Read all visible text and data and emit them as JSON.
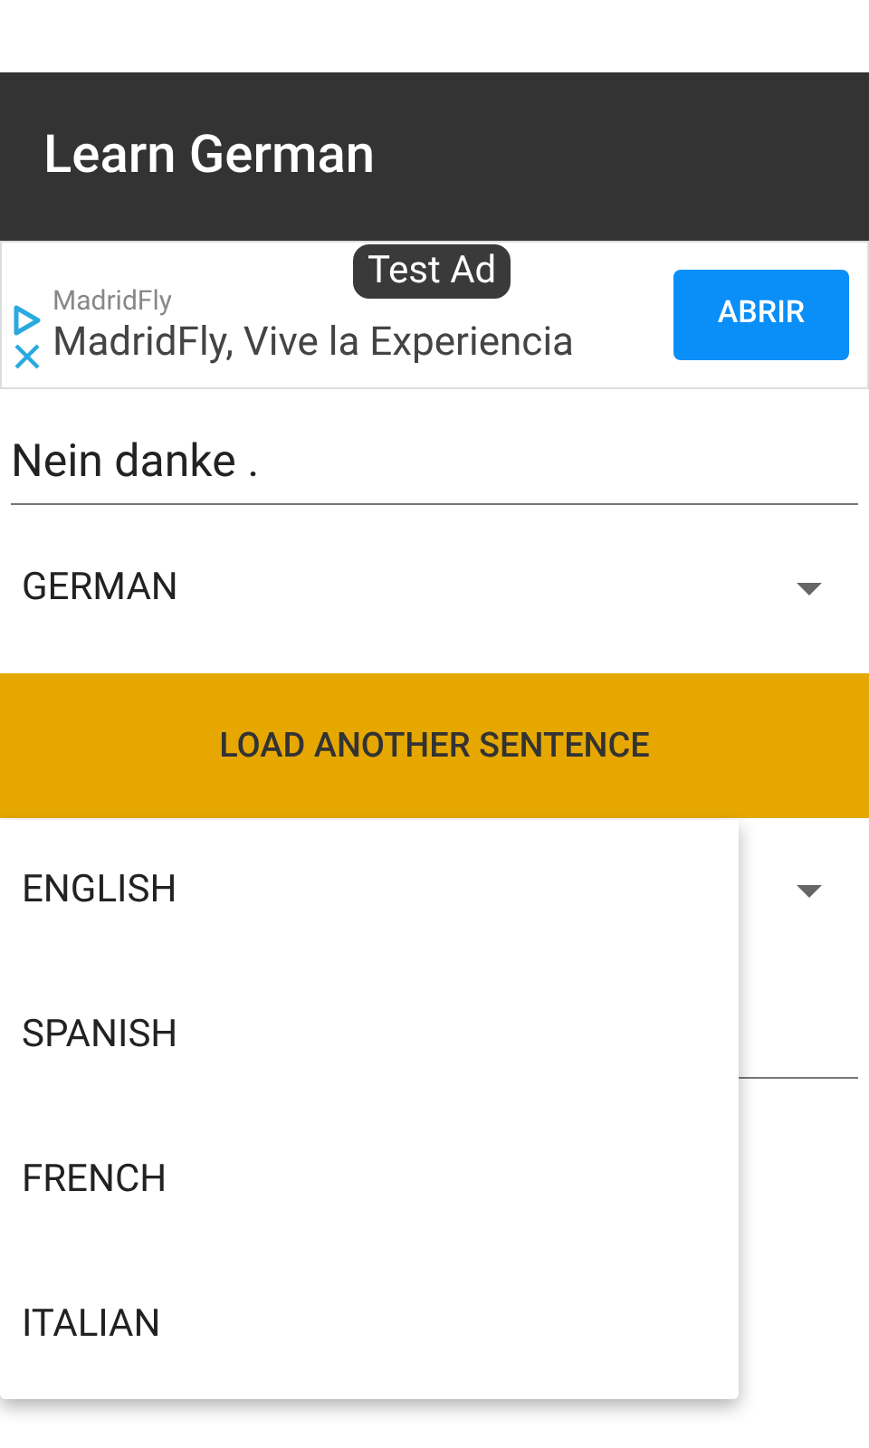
{
  "app_bar": {
    "title": "Learn German"
  },
  "ad": {
    "label": "Test Ad",
    "advertiser": "MadridFly",
    "headline": "MadridFly, Vive la Experiencia",
    "button": "ABRIR"
  },
  "sentence_field": {
    "value": "Nein danke ."
  },
  "source_language": {
    "value": "GERMAN"
  },
  "load_button": {
    "label": "LOAD ANOTHER SENTENCE"
  },
  "target_language": {
    "expanded": true,
    "options": [
      "ENGLISH",
      "SPANISH",
      "FRENCH",
      "ITALIAN"
    ]
  }
}
